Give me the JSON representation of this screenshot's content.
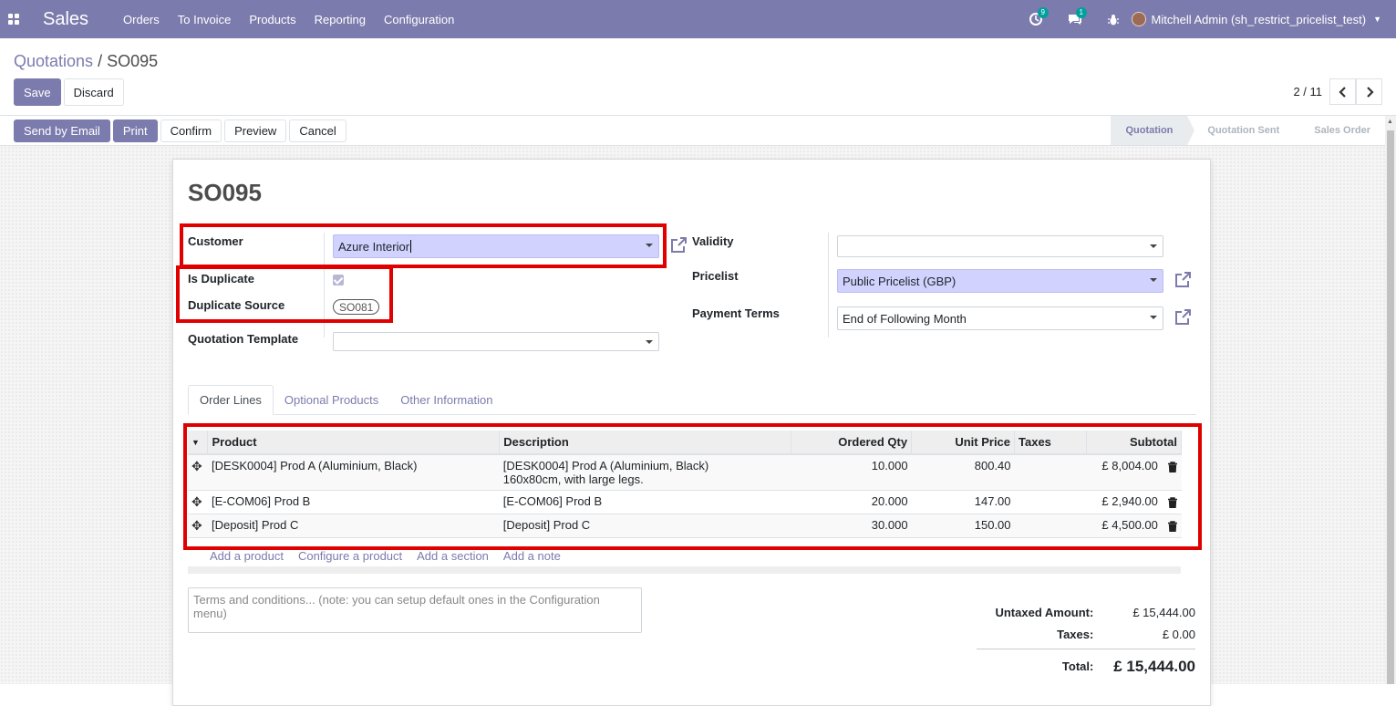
{
  "navbar": {
    "app_name": "Sales",
    "menu": [
      "Orders",
      "To Invoice",
      "Products",
      "Reporting",
      "Configuration"
    ],
    "activity_count": "9",
    "message_count": "1",
    "user": "Mitchell Admin (sh_restrict_pricelist_test)"
  },
  "breadcrumb": {
    "parent": "Quotations",
    "separator": "/",
    "current": "SO095"
  },
  "control": {
    "save": "Save",
    "discard": "Discard",
    "pager": "2 / 11"
  },
  "statusbar": {
    "buttons": [
      "Send by Email",
      "Print",
      "Confirm",
      "Preview",
      "Cancel"
    ],
    "stages": [
      "Quotation",
      "Quotation Sent",
      "Sales Order"
    ],
    "active_stage": "Quotation"
  },
  "form": {
    "name": "SO095",
    "customer_label": "Customer",
    "customer_value": "Azure Interior",
    "is_duplicate_label": "Is Duplicate",
    "is_duplicate": true,
    "duplicate_source_label": "Duplicate Source",
    "duplicate_source": "SO081",
    "template_label": "Quotation Template",
    "template_value": "",
    "validity_label": "Validity",
    "validity_value": "",
    "pricelist_label": "Pricelist",
    "pricelist_value": "Public Pricelist (GBP)",
    "payment_terms_label": "Payment Terms",
    "payment_terms_value": "End of Following Month"
  },
  "tabs": [
    "Order Lines",
    "Optional Products",
    "Other Information"
  ],
  "order_lines": {
    "columns": [
      "Product",
      "Description",
      "Ordered Qty",
      "Unit Price",
      "Taxes",
      "Subtotal"
    ],
    "rows": [
      {
        "product": "[DESK0004] Prod A (Aluminium, Black)",
        "description": "[DESK0004] Prod A (Aluminium, Black)",
        "description2": "160x80cm, with large legs.",
        "qty": "10.000",
        "price": "800.40",
        "taxes": "",
        "subtotal": "£ 8,004.00"
      },
      {
        "product": "[E-COM06] Prod B",
        "description": "[E-COM06] Prod B",
        "description2": "",
        "qty": "20.000",
        "price": "147.00",
        "taxes": "",
        "subtotal": "£ 2,940.00"
      },
      {
        "product": "[Deposit] Prod C",
        "description": "[Deposit] Prod C",
        "description2": "",
        "qty": "30.000",
        "price": "150.00",
        "taxes": "",
        "subtotal": "£ 4,500.00"
      }
    ],
    "add_links": [
      "Add a product",
      "Configure a product",
      "Add a section",
      "Add a note"
    ]
  },
  "note_placeholder": "Terms and conditions... (note: you can setup default ones in the Configuration menu)",
  "totals": {
    "untaxed_label": "Untaxed Amount:",
    "untaxed_value": "£ 15,444.00",
    "taxes_label": "Taxes:",
    "taxes_value": "£ 0.00",
    "total_label": "Total:",
    "total_value": "£ 15,444.00"
  },
  "colors": {
    "brand": "#7c7bad",
    "highlight": "#e00000",
    "filled_field": "#d2d2ff"
  }
}
